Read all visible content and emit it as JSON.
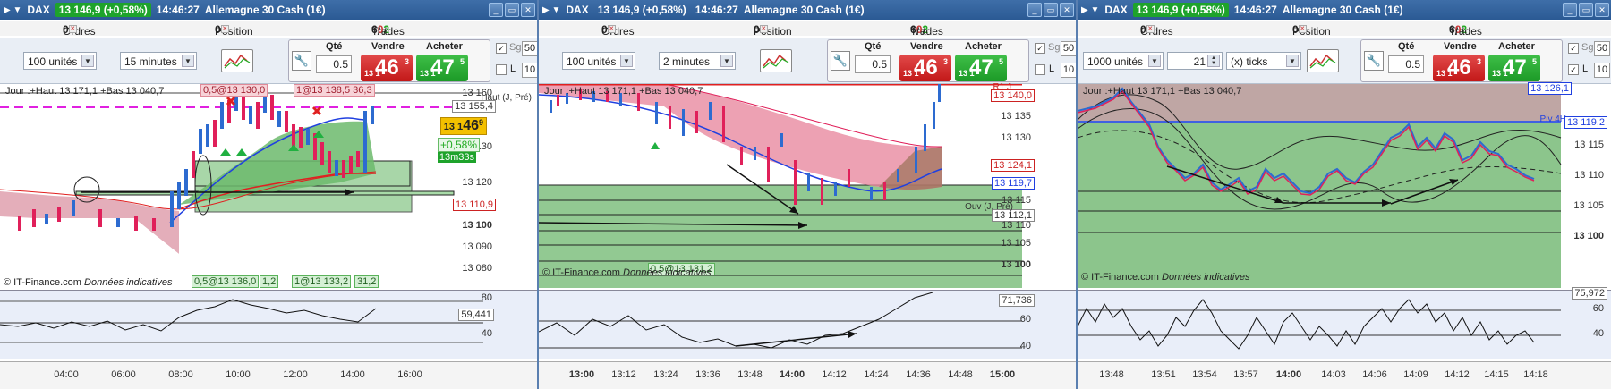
{
  "panels": [
    {
      "title": {
        "symbol": "DAX",
        "price": "13 146,9 (+0,58%)",
        "time": "14:46:27",
        "name": "Allemagne 30 Cash (1€)"
      },
      "orders_label": "Ordres :",
      "orders_value": "0",
      "position_label": "Position :",
      "position_value": "0",
      "trades_label": "Trades jour :",
      "trades_value": "6",
      "trades_sep1": "/",
      "trades_red": "0",
      "trades_sep2": "/",
      "trades_grn": "2",
      "units": "100 unités",
      "interval": "15 minutes",
      "qty_label": "Qté",
      "qty_value": "0.5",
      "sell_label": "Vendre",
      "buy_label": "Acheter",
      "sell_small": "13 1",
      "sell_big": "46",
      "sell_sup": "3",
      "buy_small": "13 1",
      "buy_big": "47",
      "buy_sup": "5",
      "sg_label": "Sg",
      "l_label": "L",
      "pts1": "50",
      "pts2": "10",
      "pts_label": "pts",
      "header_text": "Jour :+Haut 13 171,1 +Bas 13 040,7",
      "credit_a": "© IT-Finance.com",
      "credit_b": "Données indicatives",
      "price_labels": [
        "13 160",
        "13 155,4",
        "13 140",
        "13 130",
        "13 120",
        "13 110,9",
        "13 100",
        "13 090",
        "13 080"
      ],
      "current_price": {
        "prefix": "13 1",
        "big": "46",
        "sup": "9"
      },
      "change_pct": "+0,58%",
      "countdown": "13m33s",
      "tags": [
        "0,5@13 130,0",
        "1@13 138,5 36,3",
        "0,5@13 136,0",
        "1,2",
        "1@13 133,2",
        "31,2"
      ],
      "haut_label": "Haut (J, Pré)",
      "osc_labels": [
        "80",
        "59,441",
        "40"
      ],
      "time_ticks": [
        "04:00",
        "06:00",
        "08:00",
        "10:00",
        "12:00",
        "14:00",
        "16:00"
      ]
    },
    {
      "title": {
        "symbol": "DAX",
        "price": "13 146,9 (+0,58%)",
        "time": "14:46:27",
        "name": "Allemagne 30 Cash (1€)"
      },
      "orders_label": "Ordres :",
      "orders_value": "0",
      "position_label": "Position :",
      "position_value": "0",
      "trades_label": "Trades jour :",
      "trades_value": "6",
      "trades_sep1": "/",
      "trades_red": "0",
      "trades_sep2": "/",
      "trades_grn": "2",
      "units": "100 unités",
      "interval": "2 minutes",
      "qty_label": "Qté",
      "qty_value": "0.5",
      "sell_label": "Vendre",
      "buy_label": "Acheter",
      "sell_small": "13 1",
      "sell_big": "46",
      "sell_sup": "3",
      "buy_small": "13 1",
      "buy_big": "47",
      "buy_sup": "5",
      "sg_label": "Sg",
      "l_label": "L",
      "pts1": "50",
      "pts2": "10",
      "pts_label": "pts",
      "header_text": "Jour :+Haut 13 171,1 +Bas 13 040,7",
      "credit_a": "© IT-Finance.com",
      "credit_b": "Données indicatives",
      "price_labels": [
        "13 140,0",
        "13 135",
        "13 130",
        "13 124,1",
        "13 119,7",
        "13 115",
        "13 112,1",
        "13 110",
        "13 105",
        "13 100"
      ],
      "r1_label": "R1 J",
      "ouv_label": "Ouv (J, Pré)",
      "tags": [
        "0,5@13 131,2"
      ],
      "osc_labels": [
        "71,736",
        "60",
        "40"
      ],
      "time_ticks": [
        "13:00",
        "13:12",
        "13:24",
        "13:36",
        "13:48",
        "14:00",
        "14:12",
        "14:24",
        "14:36",
        "14:48",
        "15:00"
      ]
    },
    {
      "title": {
        "symbol": "DAX",
        "price": "13 146,9 (+0,58%)",
        "time": "14:46:27",
        "name": "Allemagne 30 Cash (1€)"
      },
      "orders_label": "Ordres :",
      "orders_value": "0",
      "position_label": "Position :",
      "position_value": "0",
      "trades_label": "Trades jour :",
      "trades_value": "6",
      "trades_sep1": "/",
      "trades_red": "0",
      "trades_sep2": "/",
      "trades_grn": "2",
      "units": "1000 unités",
      "ticks_value": "21",
      "interval": "(x) ticks",
      "qty_label": "Qté",
      "qty_value": "0.5",
      "sell_label": "Vendre",
      "buy_label": "Acheter",
      "sell_small": "13 1",
      "sell_big": "46",
      "sell_sup": "3",
      "buy_small": "13 1",
      "buy_big": "47",
      "buy_sup": "5",
      "sg_label": "Sg",
      "l_label": "L",
      "pts1": "50",
      "pts2": "10",
      "pts_label": "pts",
      "header_text": "Jour :+Haut 13 171,1 +Bas 13 040,7",
      "credit_a": "© IT-Finance.com",
      "credit_b": "Données indicatives",
      "price_labels": [
        "13 126,1",
        "13 119,2",
        "13 115",
        "13 110",
        "13 105",
        "13 100"
      ],
      "piv_label": "Piv 4H",
      "osc_labels": [
        "75,972",
        "60",
        "40"
      ],
      "time_ticks": [
        "13:48",
        "13:51",
        "13:54",
        "13:57",
        "14:00",
        "14:03",
        "14:06",
        "14:09",
        "14:12",
        "14:15",
        "14:18"
      ]
    }
  ],
  "colors": {
    "title_bar": "#2f5f9a",
    "price_green": "#1ea32b",
    "sell_red": "#c21818",
    "buy_green": "#1c9a27",
    "zone_green": "#7fbf7f",
    "zone_red": "#e2a0ae",
    "current_price_bg": "#f3c000"
  }
}
